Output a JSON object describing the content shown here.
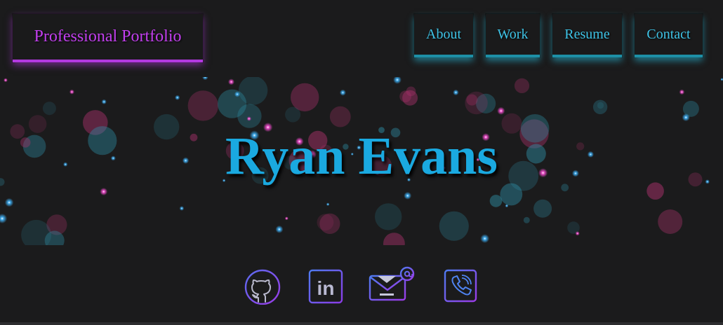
{
  "header": {
    "brand": "Professional Portfolio",
    "nav": [
      {
        "label": "About"
      },
      {
        "label": "Work"
      },
      {
        "label": "Resume"
      },
      {
        "label": "Contact"
      }
    ]
  },
  "hero": {
    "name": "Ryan Evans"
  },
  "social": [
    {
      "icon": "github-icon"
    },
    {
      "icon": "linkedin-icon"
    },
    {
      "icon": "email-icon"
    },
    {
      "icon": "phone-icon"
    }
  ],
  "colors": {
    "background": "#1b1b1c",
    "brand_accent": "#c23fee",
    "nav_accent": "#3ec3e6",
    "name_color": "#1aa9e0",
    "icon_stroke": "#8a3cf0"
  }
}
